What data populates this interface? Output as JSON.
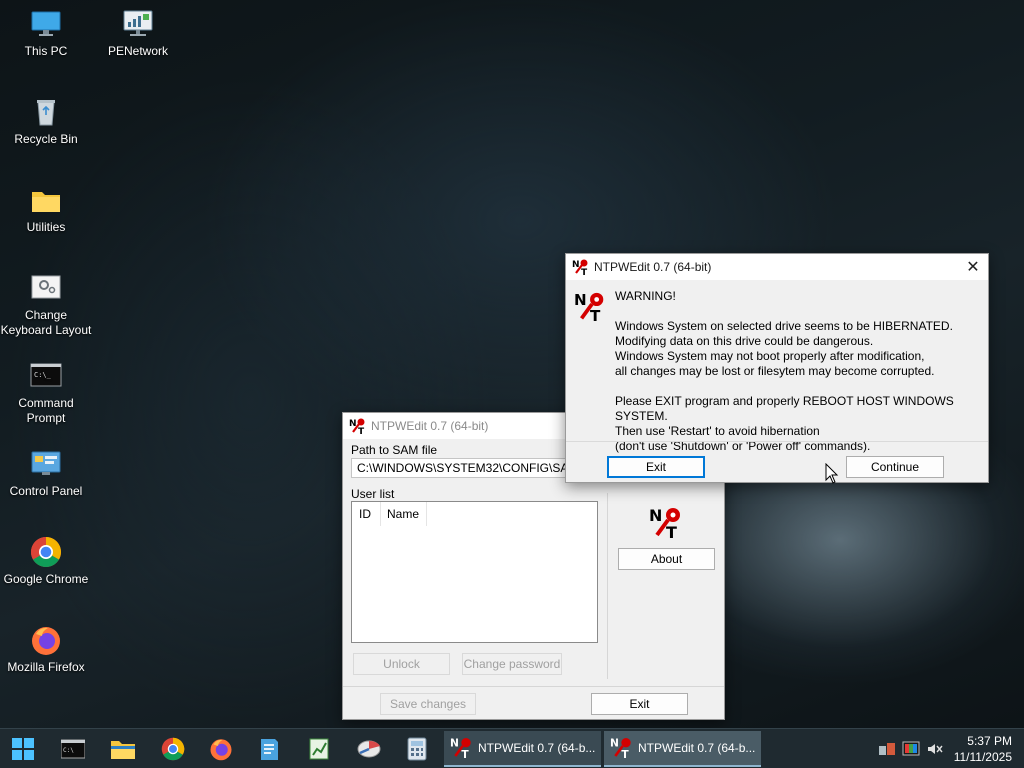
{
  "desktop": {
    "icons": [
      {
        "label": "This PC"
      },
      {
        "label": "PENetwork"
      },
      {
        "label": "Recycle Bin"
      },
      {
        "label": "Utilities"
      },
      {
        "label": "Change\nKeyboard Layout"
      },
      {
        "label": "Command\nPrompt"
      },
      {
        "label": "Control Panel"
      },
      {
        "label": "Google Chrome"
      },
      {
        "label": "Mozilla Firefox"
      }
    ]
  },
  "main_window": {
    "title": "NTPWEdit 0.7 (64-bit)",
    "sam_label": "Path to SAM file",
    "sam_path": "C:\\WINDOWS\\SYSTEM32\\CONFIG\\SAM",
    "user_list_label": "User list",
    "columns": [
      "ID",
      "Name"
    ],
    "unlock_label": "Unlock",
    "change_password_label": "Change password",
    "about_label": "About",
    "save_changes_label": "Save changes",
    "exit_label": "Exit"
  },
  "dialog": {
    "title": "NTPWEdit 0.7 (64-bit)",
    "heading": "WARNING!",
    "lines": [
      "Windows System on selected drive seems to be HIBERNATED.",
      "Modifying data on this drive could be dangerous.",
      "Windows System may not boot properly after modification,",
      "all changes may be lost or filesytem may become corrupted."
    ],
    "lines2": [
      "Please EXIT program and properly REBOOT HOST WINDOWS SYSTEM.",
      "Then use 'Restart' to avoid hibernation",
      "(don't use 'Shutdown' or 'Power off' commands)."
    ],
    "exit_label": "Exit",
    "continue_label": "Continue"
  },
  "taskbar": {
    "tasks": [
      {
        "label": "NTPWEdit 0.7 (64-b..."
      },
      {
        "label": "NTPWEdit 0.7 (64-b..."
      }
    ],
    "time": "5:37 PM",
    "date": "11/11/2025"
  },
  "colors": {
    "accent": "#0078d7",
    "logo_red": "#d40000",
    "taskbar": "#1f2a30"
  }
}
